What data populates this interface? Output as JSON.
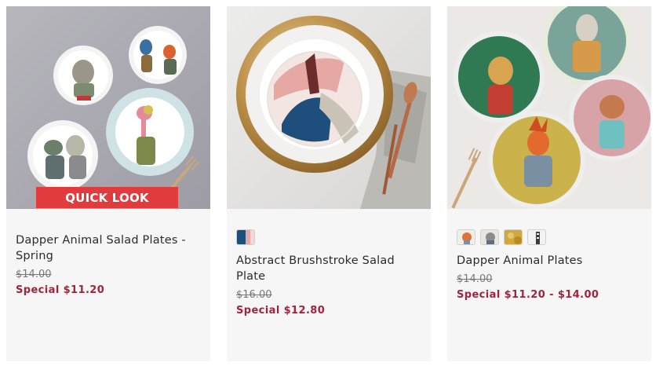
{
  "products": [
    {
      "name": "Dapper Animal Salad Plates - Spring",
      "was_price": "$14.00",
      "special_price": "Special $11.20",
      "quick_look_label": "QUICK LOOK",
      "image": "dapper-animal-salad-plates-photo",
      "swatches": []
    },
    {
      "name": "Abstract Brushstroke Salad Plate",
      "was_price": "$16.00",
      "special_price": "Special $12.80",
      "image": "abstract-brushstroke-plate-photo",
      "swatches": [
        "brushstroke-swatch"
      ]
    },
    {
      "name": "Dapper Animal Plates",
      "was_price": "$14.00",
      "special_price": "Special $11.20 - $14.00",
      "image": "dapper-animal-plates-photo",
      "swatches": [
        "orange-bird-swatch",
        "cat-swatch",
        "yellow-floral-swatch",
        "zebra-swatch"
      ]
    }
  ],
  "colors": {
    "card_bg": "#f6f6f7",
    "special": "#a1243c",
    "quick_look_bg": "#e23b3e",
    "text": "#2b2b2b"
  }
}
